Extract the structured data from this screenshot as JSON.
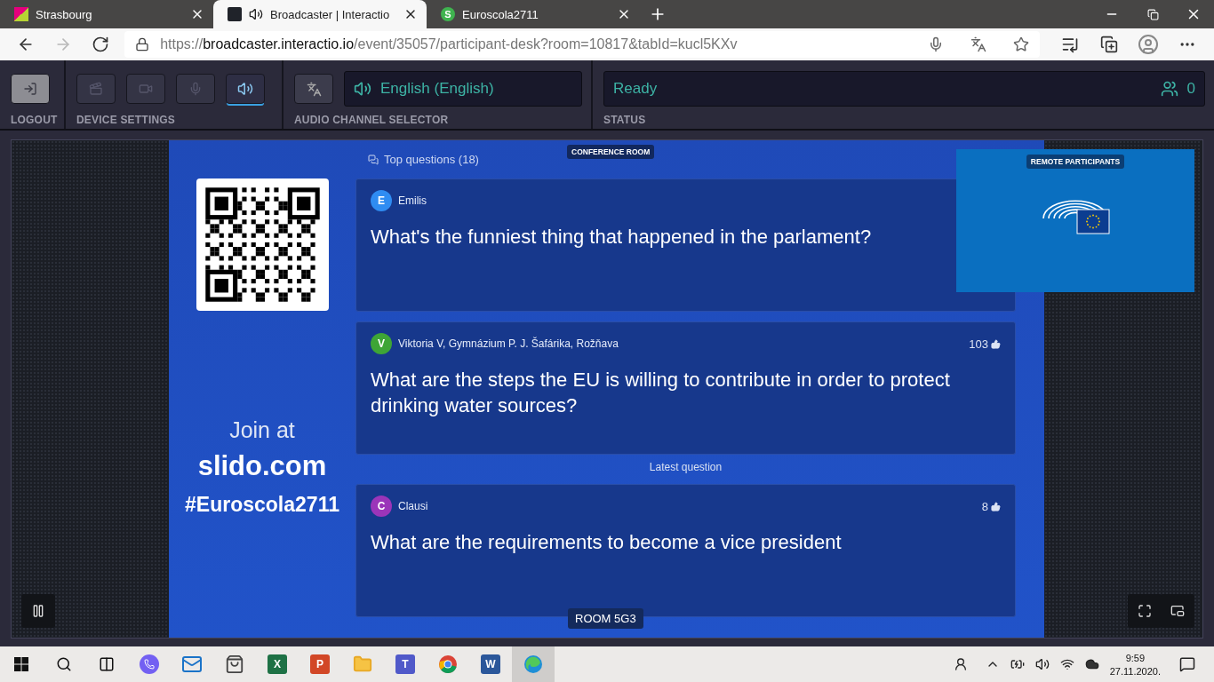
{
  "browser": {
    "tabs": [
      {
        "kind": "strasbourg",
        "title": "Strasbourg",
        "selected": false,
        "audio": false
      },
      {
        "kind": "react",
        "title": "Broadcaster | Interactio",
        "selected": true,
        "audio": true
      },
      {
        "kind": "slido",
        "letter": "S",
        "title": "Euroscola2711",
        "selected": false,
        "audio": false
      }
    ],
    "url_scheme": "https://",
    "url_host": "broadcaster.interactio.io",
    "url_path": "/event/35057/participant-desk?room=10817&tabId=kucl5KXv",
    "forward_disabled": true
  },
  "toolbar": {
    "logout_label": "LOGOUT",
    "device_label": "DEVICE SETTINGS",
    "devices": [
      {
        "kind": "screen",
        "selected": false
      },
      {
        "kind": "camera",
        "selected": false
      },
      {
        "kind": "mic",
        "selected": false
      },
      {
        "kind": "speaker",
        "selected": true
      }
    ],
    "channel_label": "AUDIO CHANNEL SELECTOR",
    "channel": "English (English)",
    "status_label": "STATUS",
    "status": "Ready",
    "participants": "0"
  },
  "video": {
    "room_badge": "CONFERENCE ROOM",
    "remote_badge": "REMOTE PARTICIPANTS",
    "room_name": "ROOM 5G3",
    "slide": {
      "top_questions": "Top questions (18)",
      "join": "Join at",
      "site": "slido.com",
      "hashtag": "#Euroscola2711",
      "latest_label": "Latest question",
      "questions": [
        {
          "initial": "E",
          "color": "#2f8cf2",
          "author": "Emilis",
          "text": "What's the funniest thing that happened in the parlament?"
        },
        {
          "initial": "V",
          "color": "#3ea536",
          "author": "Viktoria V, Gymnázium P. J. Šafárika, Rožňava",
          "likes": "103",
          "text": "What are the steps the EU is willing to contribute in order to protect drinking water sources?"
        },
        {
          "initial": "C",
          "color": "#9b35b9",
          "author": "Clausi",
          "likes": "8",
          "text": "What are the requirements to become a vice president"
        }
      ]
    }
  },
  "taskbar": {
    "apps": [
      {
        "kind": "viber",
        "selected": false
      },
      {
        "kind": "mail",
        "selected": false
      },
      {
        "kind": "store",
        "selected": false
      },
      {
        "kind": "excel",
        "letter": "X",
        "selected": false
      },
      {
        "kind": "powerpoint",
        "letter": "P",
        "selected": false
      },
      {
        "kind": "explorer",
        "selected": false
      },
      {
        "kind": "teams",
        "letter": "T",
        "selected": false
      },
      {
        "kind": "chrome",
        "selected": false
      },
      {
        "kind": "word",
        "letter": "W",
        "selected": false
      },
      {
        "kind": "edge",
        "selected": true
      }
    ],
    "time": "9:59",
    "date": "27.11.2020."
  }
}
